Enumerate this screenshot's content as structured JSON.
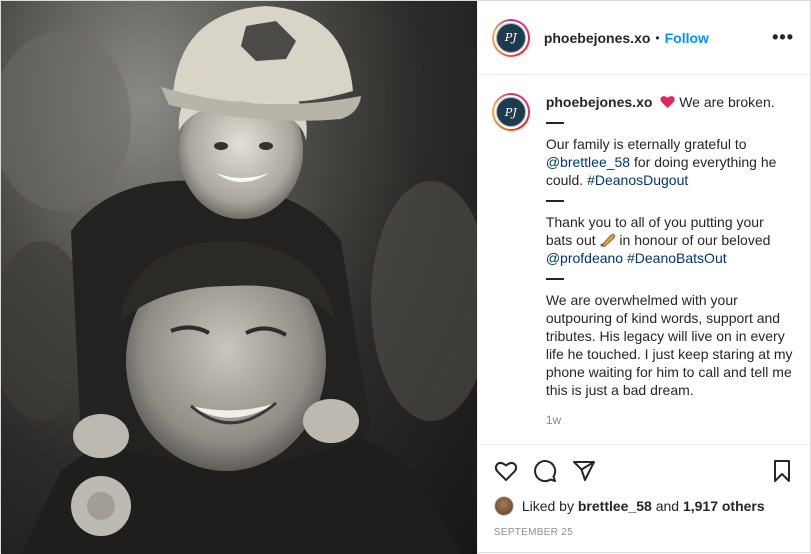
{
  "post": {
    "username": "phoebejones.xo",
    "avatar_initials": "PJ",
    "separator": "•",
    "follow_label": "Follow",
    "more_label": "•••"
  },
  "caption": {
    "username": "phoebejones.xo",
    "heart_icon": "red-heart-emoji",
    "p1": "We are broken.",
    "p2_a": "Our family is eternally grateful to",
    "p2_mention": "@brettlee_58",
    "p2_b": " for doing everything he could. ",
    "p2_hashtag": "#DeanosDugout",
    "p3_a": "Thank you to all of you putting your bats out ",
    "bat_icon": "cricket-bat-emoji",
    "p3_b": " in honour of our beloved",
    "p3_mention": "@profdeano",
    "p3_hashtag": "#DeanoBatsOut",
    "p4": "We are overwhelmed with your outpouring of kind words, support and tributes. His legacy will live on in every life he touched. I just keep staring at my phone waiting for him to call and tell me this is just a bad dream.",
    "time": "1w"
  },
  "actions": {
    "icons": [
      "heart-icon",
      "comment-icon",
      "share-icon",
      "bookmark-icon"
    ],
    "liked_by_prefix": "Liked by ",
    "liked_by_user": "brettlee_58",
    "liked_by_mid": " and ",
    "liked_by_count": "1,917 others",
    "date": "SEPTEMBER 25"
  },
  "colors": {
    "link": "#00376b",
    "follow": "#0095f6",
    "muted": "#8e8e8e",
    "heart": "#e0245e"
  }
}
